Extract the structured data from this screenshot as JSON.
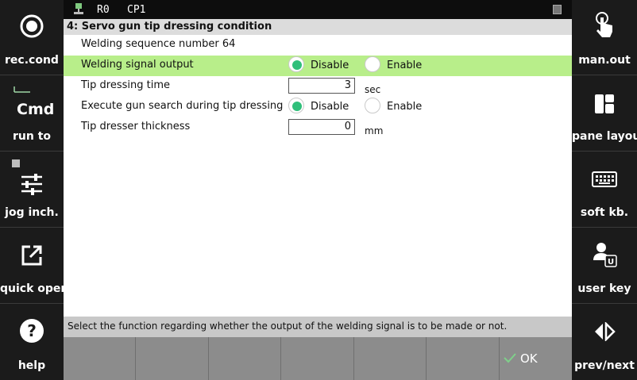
{
  "left_panel": [
    {
      "label": "rec.cond",
      "icon": "record-icon"
    },
    {
      "label": "run to",
      "icon": "cmd-icon",
      "icon_text": "Cmd"
    },
    {
      "label": "jog inch.",
      "icon": "sliders-icon"
    },
    {
      "label": "quick open",
      "icon": "open-external-icon"
    },
    {
      "label": "help",
      "icon": "help-icon"
    }
  ],
  "right_panel": [
    {
      "label": "man.out",
      "icon": "touch-hand-icon"
    },
    {
      "label": "pane layout",
      "icon": "pane-layout-icon"
    },
    {
      "label": "soft kb.",
      "icon": "keyboard-icon"
    },
    {
      "label": "user key",
      "icon": "user-key-icon"
    },
    {
      "label": "prev/next",
      "icon": "prev-next-icon"
    }
  ],
  "topbar": {
    "robot": "R0",
    "program": "CP1"
  },
  "title": "4: Servo gun tip dressing condition",
  "sequence_label": "Welding sequence number 64",
  "rows": {
    "welding_signal": {
      "label": "Welding signal output",
      "options": [
        "Disable",
        "Enable"
      ],
      "selected": "Disable"
    },
    "tip_time": {
      "label": "Tip dressing time",
      "value": "3",
      "unit": "sec"
    },
    "gun_search": {
      "label": "Execute gun search during tip dressing",
      "options": [
        "Disable",
        "Enable"
      ],
      "selected": "Disable"
    },
    "dresser_thickness": {
      "label": "Tip dresser thickness",
      "value": "0",
      "unit": "mm"
    }
  },
  "status_message": "Select the function regarding whether the output of the welding signal is to be made or not.",
  "ok_label": "OK",
  "colors": {
    "highlight": "#b8ee8a",
    "radio_on": "#2fbf7a",
    "ok_check": "#7fd08a"
  }
}
